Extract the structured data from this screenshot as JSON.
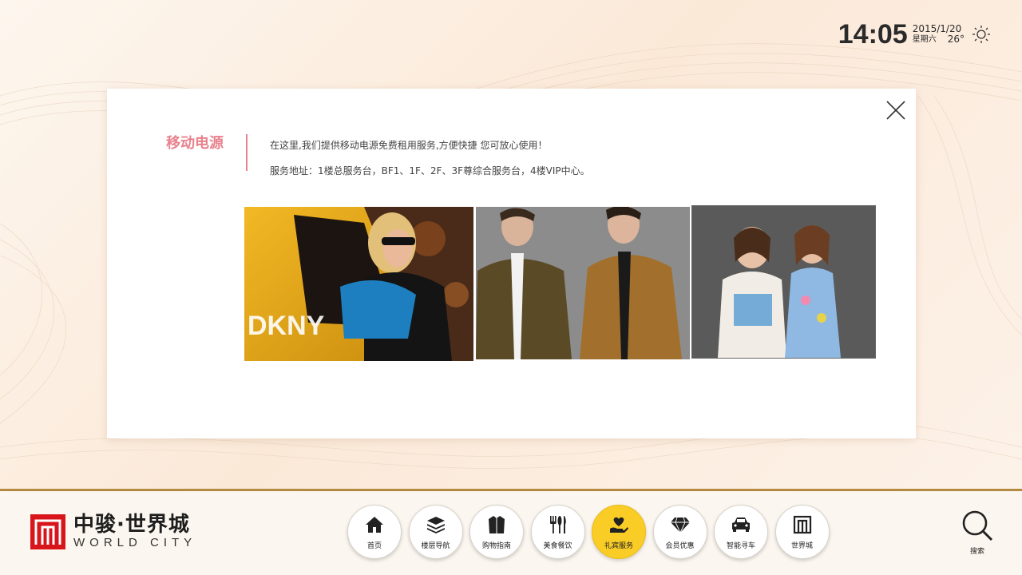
{
  "clock": {
    "time": "14:05",
    "date": "2015/1/20",
    "weekday": "星期六",
    "temperature": "26°",
    "weather_icon": "sun-icon"
  },
  "card": {
    "title": "移动电源",
    "line1": "在这里,我们提供移动电源免费租用服务,方便快捷  您可放心使用！",
    "line2": "服务地址：1楼总服务台，BF1、1F、2F、3F尊综合服务台，4楼VIP中心。",
    "photo1_brand": "DKNY",
    "close_icon": "close-icon"
  },
  "logo": {
    "cn": "中骏·世界城",
    "en": "WORLD CITY"
  },
  "nav": {
    "items": [
      {
        "label": "首页",
        "icon": "home-icon"
      },
      {
        "label": "楼层导航",
        "icon": "layers-icon"
      },
      {
        "label": "购物指南",
        "icon": "jacket-icon"
      },
      {
        "label": "美食餐饮",
        "icon": "cutlery-icon"
      },
      {
        "label": "礼宾服务",
        "icon": "heart-hand-icon"
      },
      {
        "label": "会员优惠",
        "icon": "diamond-icon"
      },
      {
        "label": "智能寻车",
        "icon": "car-icon"
      },
      {
        "label": "世界城",
        "icon": "world-city-icon"
      }
    ],
    "active_index": 4
  },
  "search": {
    "label": "搜索",
    "icon": "search-icon"
  },
  "colors": {
    "accent_pink": "#e8828d",
    "active_yellow": "#f9cd25",
    "gold_line": "#b48a43",
    "logo_red": "#d7151b"
  }
}
